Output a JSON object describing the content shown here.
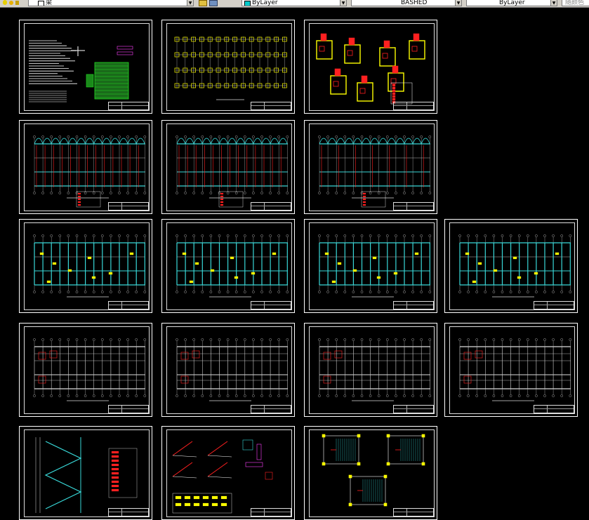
{
  "toolbar": {
    "layer_name": "梁",
    "color_value": "ByLayer",
    "linetype_value": "BASHED",
    "lineweight_value": "ByLayer",
    "plotstyle_value": "随颜色"
  },
  "colors": {
    "background": "#000000",
    "frame": "#ffffff",
    "cyan": "#38d8d8",
    "yellow": "#ffff00",
    "red": "#ff2020",
    "green": "#22dd22",
    "magenta": "#ff40ff"
  },
  "icons": [
    "layer-state-icon",
    "lightbulb-icon",
    "sun-icon",
    "lock-icon",
    "layer-color-icon",
    "layer-manager-icon",
    "color-swatch-icon",
    "chevron-down-icon"
  ],
  "sheets": [
    {
      "kind": "notes"
    },
    {
      "kind": "foundation_plan"
    },
    {
      "kind": "foundation_details"
    },
    {
      "kind": "column_plan"
    },
    {
      "kind": "column_plan"
    },
    {
      "kind": "column_plan"
    },
    {
      "kind": "beam_plan"
    },
    {
      "kind": "beam_plan"
    },
    {
      "kind": "beam_plan"
    },
    {
      "kind": "beam_plan"
    },
    {
      "kind": "slab_plan"
    },
    {
      "kind": "slab_plan"
    },
    {
      "kind": "slab_plan"
    },
    {
      "kind": "slab_plan"
    },
    {
      "kind": "stair_section"
    },
    {
      "kind": "stair_details"
    },
    {
      "kind": "stair_plans"
    }
  ]
}
